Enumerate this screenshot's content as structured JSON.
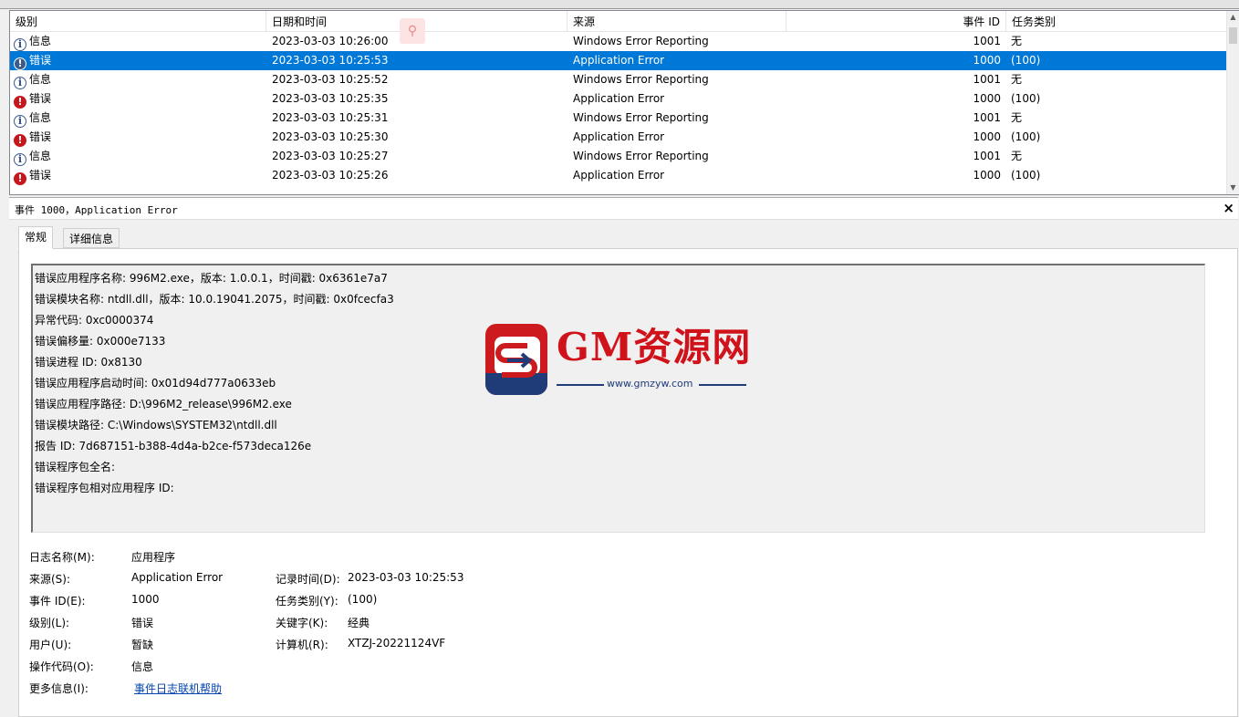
{
  "top_strip_text": "· · · · ·",
  "list": {
    "headers": {
      "level": "级别",
      "datetime": "日期和时间",
      "source": "来源",
      "event_id": "事件 ID",
      "task": "任务类别"
    },
    "rows": [
      {
        "level": "信息",
        "icon": "info-icon",
        "datetime": "2023-03-03 10:26:00",
        "source": "Windows Error Reporting",
        "event_id": "1001",
        "task": "无"
      },
      {
        "level": "错误",
        "icon": "error-icon",
        "datetime": "2023-03-03 10:25:53",
        "source": "Application Error",
        "event_id": "1000",
        "task": "(100)",
        "selected": true
      },
      {
        "level": "信息",
        "icon": "info-icon",
        "datetime": "2023-03-03 10:25:52",
        "source": "Windows Error Reporting",
        "event_id": "1001",
        "task": "无"
      },
      {
        "level": "错误",
        "icon": "error-icon",
        "datetime": "2023-03-03 10:25:35",
        "source": "Application Error",
        "event_id": "1000",
        "task": "(100)"
      },
      {
        "level": "信息",
        "icon": "info-icon",
        "datetime": "2023-03-03 10:25:31",
        "source": "Windows Error Reporting",
        "event_id": "1001",
        "task": "无"
      },
      {
        "level": "错误",
        "icon": "error-icon",
        "datetime": "2023-03-03 10:25:30",
        "source": "Application Error",
        "event_id": "1000",
        "task": "(100)"
      },
      {
        "level": "信息",
        "icon": "info-icon",
        "datetime": "2023-03-03 10:25:27",
        "source": "Windows Error Reporting",
        "event_id": "1001",
        "task": "无"
      },
      {
        "level": "错误",
        "icon": "error-icon",
        "datetime": "2023-03-03 10:25:26",
        "source": "Application Error",
        "event_id": "1000",
        "task": "(100)"
      }
    ]
  },
  "detail": {
    "title": "事件 1000，Application Error",
    "close_glyph": "×",
    "tabs": [
      "常规",
      "详细信息"
    ],
    "description_lines": [
      "错误应用程序名称: 996M2.exe，版本: 1.0.0.1，时间戳: 0x6361e7a7",
      "错误模块名称: ntdll.dll，版本: 10.0.19041.2075，时间戳: 0x0fcecfa3",
      "异常代码: 0xc0000374",
      "错误偏移量: 0x000e7133",
      "错误进程 ID: 0x8130",
      "错误应用程序启动时间: 0x01d94d777a0633eb",
      "错误应用程序路径: D:\\996M2_release\\996M2.exe",
      "错误模块路径: C:\\Windows\\SYSTEM32\\ntdll.dll",
      "报告 ID: 7d687151-b388-4d4a-b2ce-f573deca126e",
      "错误程序包全名:",
      "错误程序包相对应用程序 ID:"
    ],
    "properties": {
      "log_name_label": "日志名称(M):",
      "log_name": "应用程序",
      "source_label": "来源(S):",
      "source": "Application Error",
      "logged_label": "记录时间(D):",
      "logged": "2023-03-03 10:25:53",
      "event_id_label": "事件 ID(E):",
      "event_id": "1000",
      "task_label": "任务类别(Y):",
      "task": "(100)",
      "level_label": "级别(L):",
      "level": "错误",
      "keywords_label": "关键字(K):",
      "keywords": "经典",
      "user_label": "用户(U):",
      "user": "暂缺",
      "computer_label": "计算机(R):",
      "computer": "XTZJ-20221124VF",
      "opcode_label": "操作代码(O):",
      "opcode": "信息",
      "more_info_label": "更多信息(I):",
      "more_info_link": "事件日志联机帮助"
    }
  },
  "watermark": {
    "brand": "GM资源网",
    "url": "www.gmzyw.com"
  },
  "colors": {
    "selection": "#0078d7",
    "error": "#c8161d",
    "link": "#0645ad",
    "watermark_red": "#d0131b",
    "watermark_blue": "#1f3b78"
  }
}
